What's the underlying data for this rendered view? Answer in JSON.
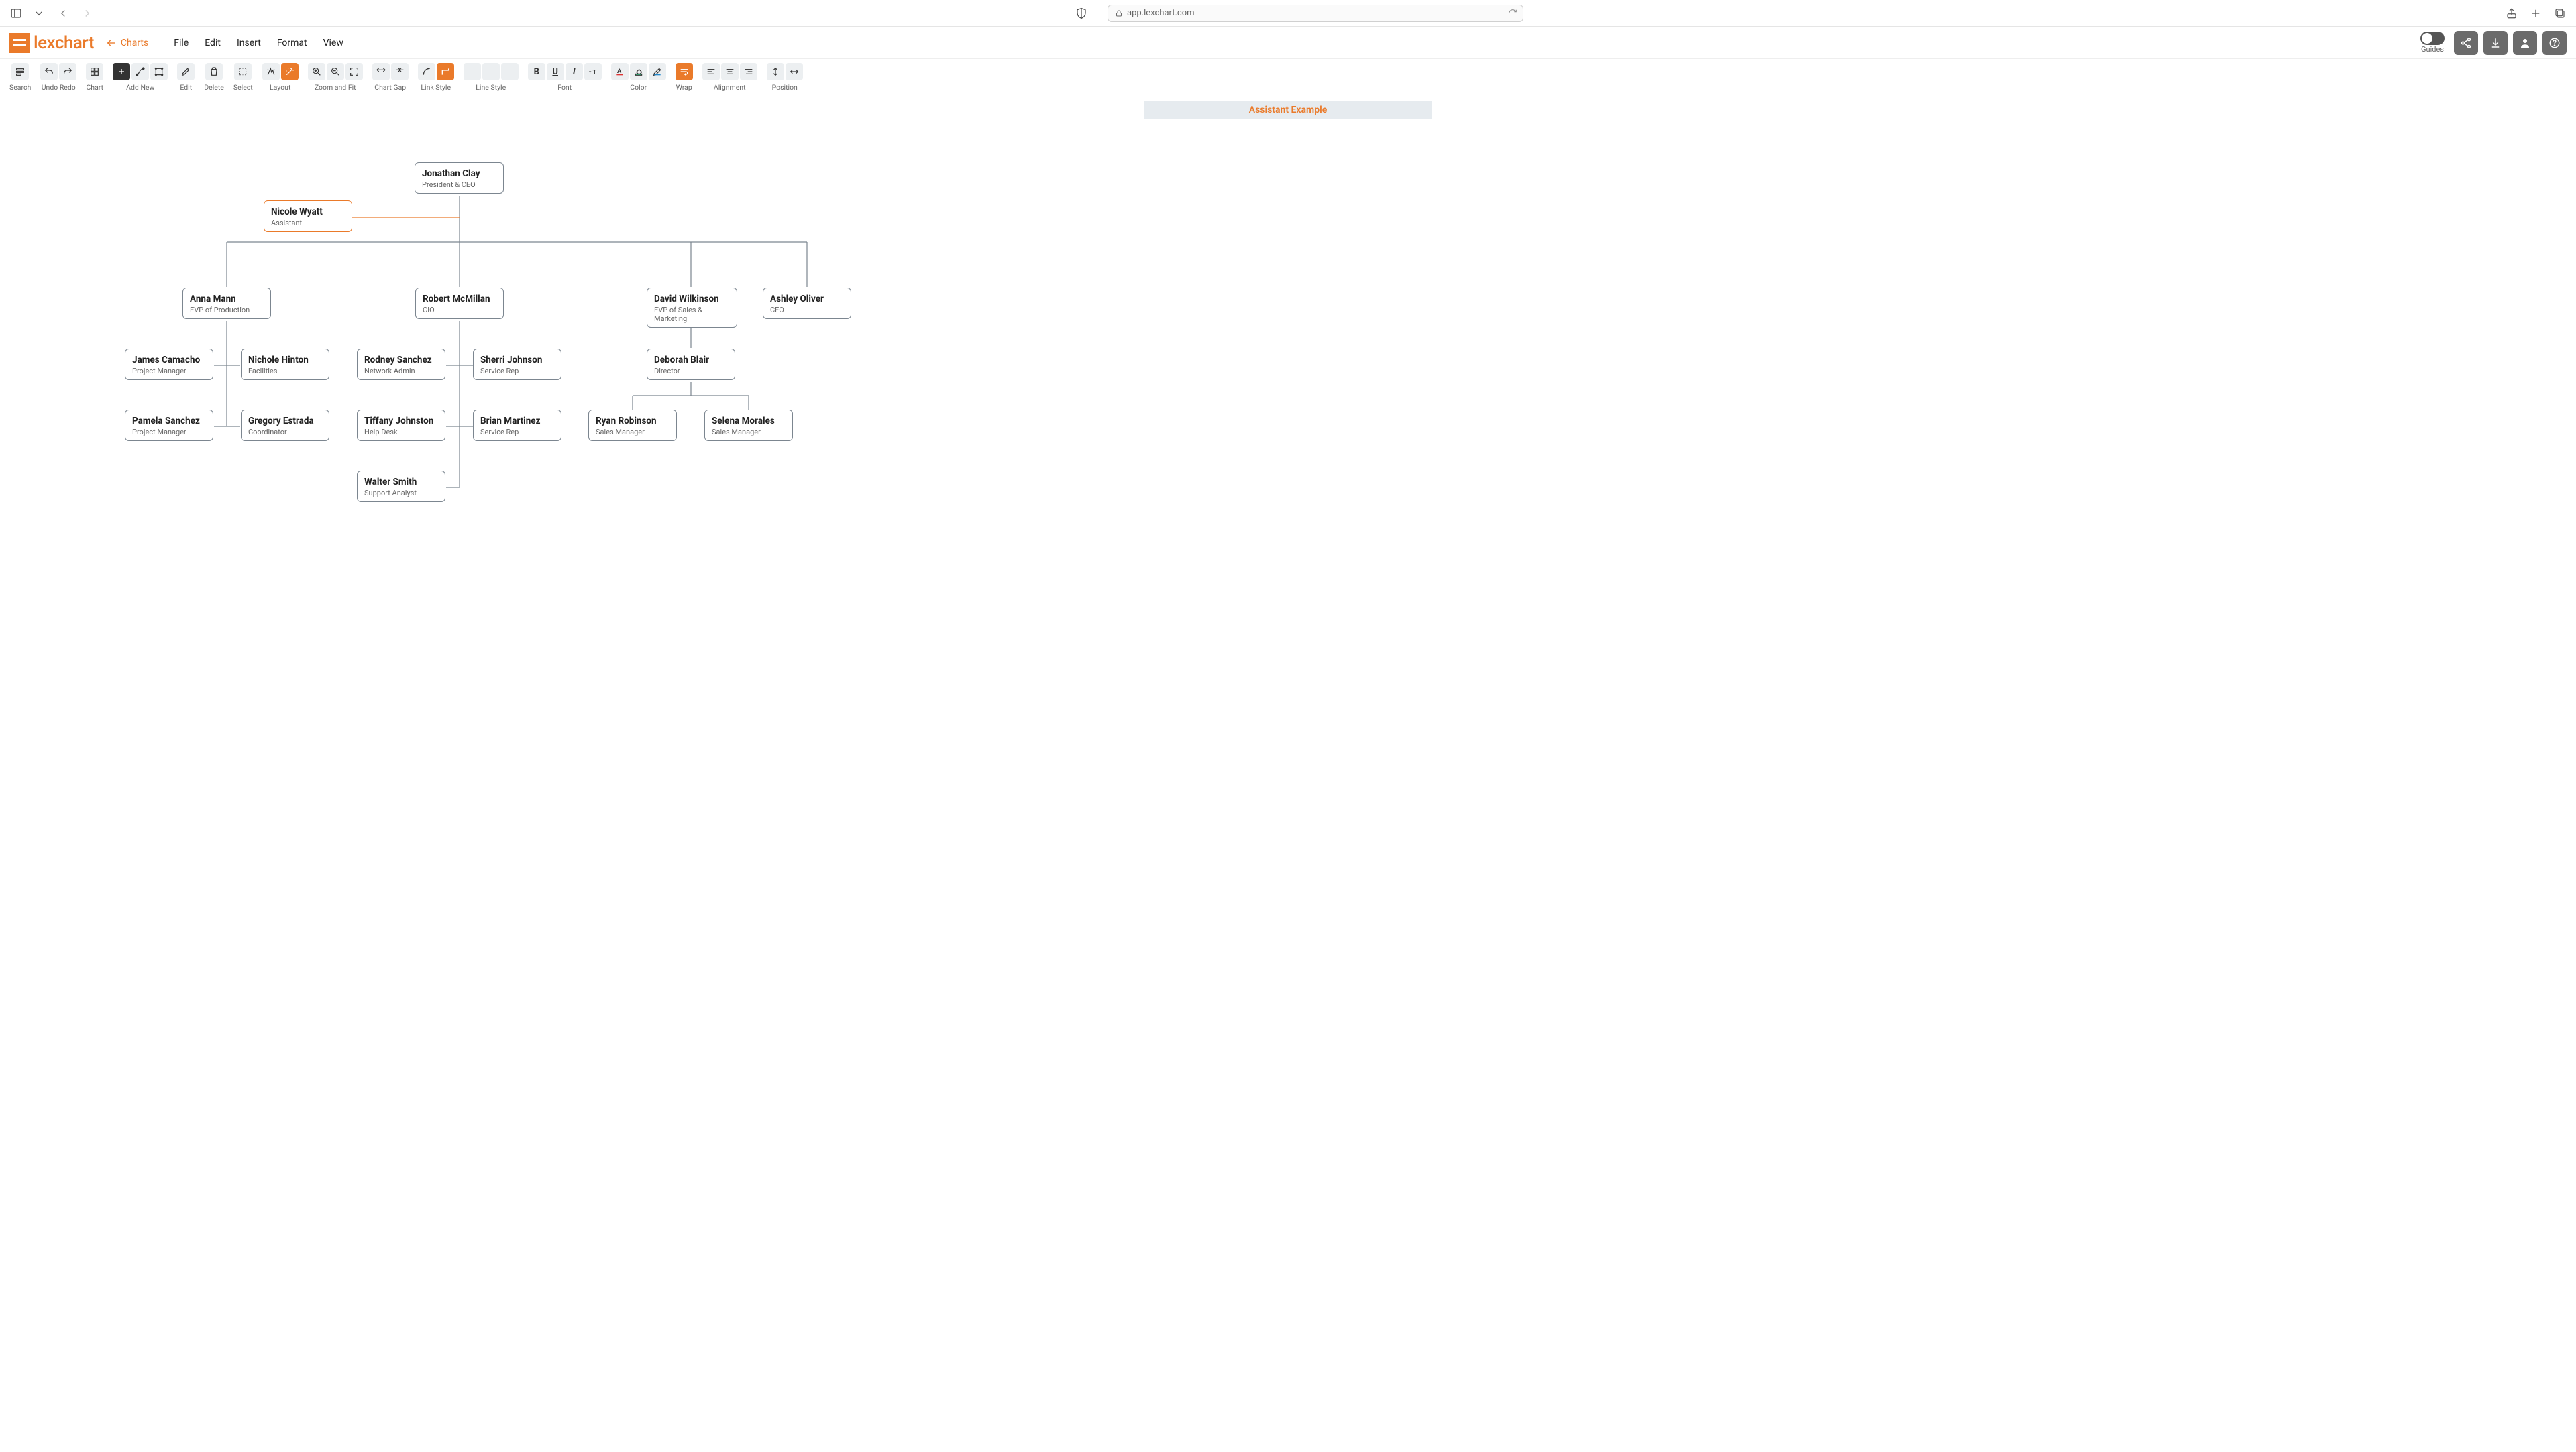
{
  "browser": {
    "url_host": "app.lexchart.com"
  },
  "app": {
    "logo_text": "lexchart",
    "menu": {
      "charts": "Charts",
      "file": "File",
      "edit": "Edit",
      "insert": "Insert",
      "format": "Format",
      "view": "View"
    },
    "guides_label": "Guides"
  },
  "toolbar": {
    "search": "Search",
    "undo_redo": "Undo Redo",
    "chart": "Chart",
    "add_new": "Add New",
    "edit": "Edit",
    "delete": "Delete",
    "select": "Select",
    "layout": "Layout",
    "zoom_fit": "Zoom and Fit",
    "chart_gap": "Chart Gap",
    "link_style": "Link Style",
    "line_style": "Line Style",
    "font": "Font",
    "color": "Color",
    "wrap": "Wrap",
    "alignment": "Alignment",
    "position": "Position"
  },
  "chart": {
    "title": "Assistant Example",
    "nodes": {
      "ceo": {
        "name": "Jonathan Clay",
        "title": "President & CEO"
      },
      "assistant": {
        "name": "Nicole Wyatt",
        "title": "Assistant"
      },
      "evp_prod": {
        "name": "Anna Mann",
        "title": "EVP of Production"
      },
      "cio": {
        "name": "Robert McMillan",
        "title": "CIO"
      },
      "evp_sales": {
        "name": "David Wilkinson",
        "title": "EVP of Sales & Marketing"
      },
      "cfo": {
        "name": "Ashley Oliver",
        "title": "CFO"
      },
      "pm1": {
        "name": "James Camacho",
        "title": "Project Manager"
      },
      "fac": {
        "name": "Nichole Hinton",
        "title": "Facilities"
      },
      "pm2": {
        "name": "Pamela Sanchez",
        "title": "Project Manager"
      },
      "coord": {
        "name": "Gregory Estrada",
        "title": "Coordinator"
      },
      "netadmin": {
        "name": "Rodney Sanchez",
        "title": "Network Admin"
      },
      "svc1": {
        "name": "Sherri Johnson",
        "title": "Service Rep"
      },
      "helpdesk": {
        "name": "Tiffany Johnston",
        "title": "Help Desk"
      },
      "svc2": {
        "name": "Brian Martinez",
        "title": "Service Rep"
      },
      "support": {
        "name": "Walter Smith",
        "title": "Support Analyst"
      },
      "director": {
        "name": "Deborah Blair",
        "title": "Director"
      },
      "sm1": {
        "name": "Ryan Robinson",
        "title": "Sales Manager"
      },
      "sm2": {
        "name": "Selena Morales",
        "title": "Sales Manager"
      }
    }
  },
  "chart_data": {
    "type": "org-chart",
    "title": "Assistant Example",
    "root": "ceo",
    "people": [
      {
        "id": "ceo",
        "name": "Jonathan Clay",
        "title": "President & CEO",
        "reports_to": null
      },
      {
        "id": "assistant",
        "name": "Nicole Wyatt",
        "title": "Assistant",
        "reports_to": "ceo",
        "assistant": true,
        "selected": true
      },
      {
        "id": "evp_prod",
        "name": "Anna Mann",
        "title": "EVP of Production",
        "reports_to": "ceo"
      },
      {
        "id": "cio",
        "name": "Robert McMillan",
        "title": "CIO",
        "reports_to": "ceo"
      },
      {
        "id": "evp_sales",
        "name": "David Wilkinson",
        "title": "EVP of Sales & Marketing",
        "reports_to": "ceo"
      },
      {
        "id": "cfo",
        "name": "Ashley Oliver",
        "title": "CFO",
        "reports_to": "ceo"
      },
      {
        "id": "pm1",
        "name": "James Camacho",
        "title": "Project Manager",
        "reports_to": "evp_prod"
      },
      {
        "id": "fac",
        "name": "Nichole Hinton",
        "title": "Facilities",
        "reports_to": "evp_prod"
      },
      {
        "id": "pm2",
        "name": "Pamela Sanchez",
        "title": "Project Manager",
        "reports_to": "evp_prod"
      },
      {
        "id": "coord",
        "name": "Gregory Estrada",
        "title": "Coordinator",
        "reports_to": "evp_prod"
      },
      {
        "id": "netadmin",
        "name": "Rodney Sanchez",
        "title": "Network Admin",
        "reports_to": "cio"
      },
      {
        "id": "svc1",
        "name": "Sherri Johnson",
        "title": "Service Rep",
        "reports_to": "cio"
      },
      {
        "id": "helpdesk",
        "name": "Tiffany Johnston",
        "title": "Help Desk",
        "reports_to": "cio"
      },
      {
        "id": "svc2",
        "name": "Brian Martinez",
        "title": "Service Rep",
        "reports_to": "cio"
      },
      {
        "id": "support",
        "name": "Walter Smith",
        "title": "Support Analyst",
        "reports_to": "cio"
      },
      {
        "id": "director",
        "name": "Deborah Blair",
        "title": "Director",
        "reports_to": "evp_sales"
      },
      {
        "id": "sm1",
        "name": "Ryan Robinson",
        "title": "Sales Manager",
        "reports_to": "director"
      },
      {
        "id": "sm2",
        "name": "Selena Morales",
        "title": "Sales Manager",
        "reports_to": "director"
      }
    ]
  }
}
